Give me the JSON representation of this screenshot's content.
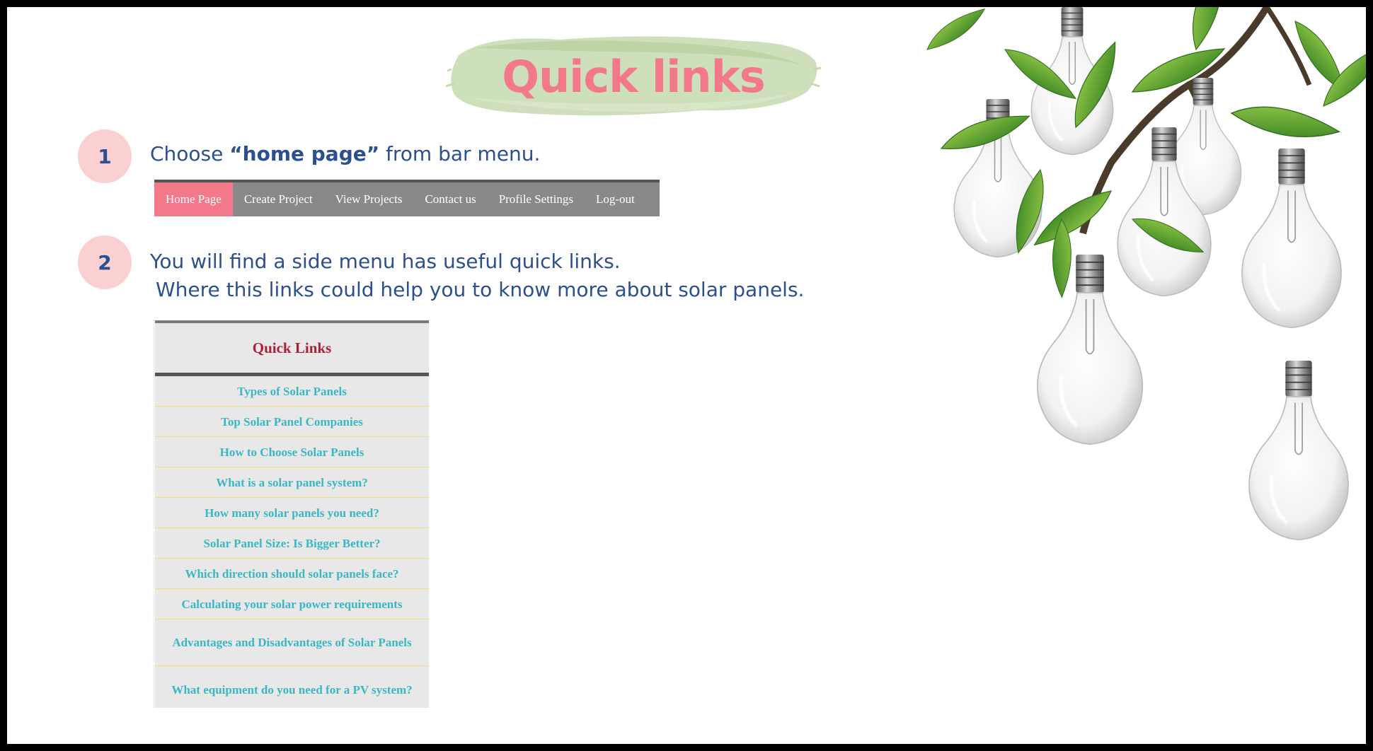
{
  "title": "Quick links",
  "steps": [
    {
      "number": "1",
      "text_before": "Choose ",
      "text_bold": "“home page”",
      "text_after": " from bar menu."
    },
    {
      "number": "2",
      "line1": "You will find a side menu has useful quick links.",
      "line2": "Where this links could help you to know more about solar panels."
    }
  ],
  "navbar": {
    "items": [
      {
        "label": "Home Page",
        "active": true
      },
      {
        "label": "Create Project"
      },
      {
        "label": "View Projects"
      },
      {
        "label": "Contact us"
      },
      {
        "label": "Profile Settings"
      },
      {
        "label": "Log-out"
      }
    ]
  },
  "quick_links": {
    "heading": "Quick Links",
    "items": [
      "Types of Solar Panels",
      "Top Solar Panel Companies",
      "How to Choose Solar Panels",
      "What is a solar panel system?",
      "How many solar panels you need?",
      "Solar Panel Size: Is Bigger Better?",
      "Which direction should solar panels face?",
      "Calculating your solar power requirements",
      "Advantages and Disadvantages of Solar Panels",
      "What equipment do you need for a PV system?"
    ]
  },
  "colors": {
    "title": "#f2788a",
    "brush": "#c6d9b0",
    "badge_bg": "#fbd0d3",
    "step_text": "#2c4f8f",
    "nav_bg": "#898989",
    "nav_active": "#f2788a",
    "ql_heading": "#a8213a",
    "ql_link": "#3bb7c4"
  },
  "decoration": {
    "icon": "lightbulbs-with-leaves-illustration"
  }
}
